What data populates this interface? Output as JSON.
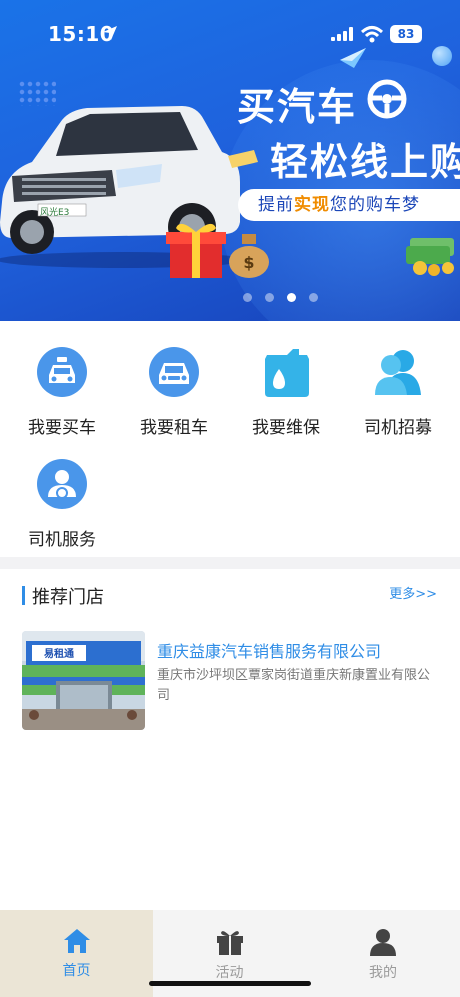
{
  "status_bar": {
    "time": "15:10",
    "battery": "83"
  },
  "banner": {
    "headline_line1": "买汽车",
    "headline_line2": "轻松线上购",
    "tagline_pre": "提前",
    "tagline_highlight": "实现",
    "tagline_post": "您的购车梦",
    "car_badge": "风光E3",
    "page_count": 4,
    "active_page": 3,
    "colors": {
      "background": "#1f62dd",
      "highlight": "#f08c00"
    }
  },
  "menu": {
    "items": [
      {
        "label": "我要买车",
        "icon": "taxi-car-icon"
      },
      {
        "label": "我要租车",
        "icon": "rental-car-icon"
      },
      {
        "label": "我要维保",
        "icon": "oil-can-icon"
      },
      {
        "label": "司机招募",
        "icon": "people-icon"
      },
      {
        "label": "司机服务",
        "icon": "driver-icon"
      }
    ]
  },
  "recommended": {
    "title": "推荐门店",
    "more": "更多>>",
    "stores": [
      {
        "name": "重庆益康汽车销售服务有限公司",
        "address": "重庆市沙坪坝区覃家岗街道重庆新康置业有限公司",
        "sign_text": "易租通"
      }
    ]
  },
  "tabbar": {
    "tabs": [
      {
        "label": "首页",
        "icon": "home-icon",
        "active": true
      },
      {
        "label": "活动",
        "icon": "gift-icon",
        "active": false
      },
      {
        "label": "我的",
        "icon": "user-icon",
        "active": false
      }
    ],
    "accent": "#2f8de6"
  }
}
